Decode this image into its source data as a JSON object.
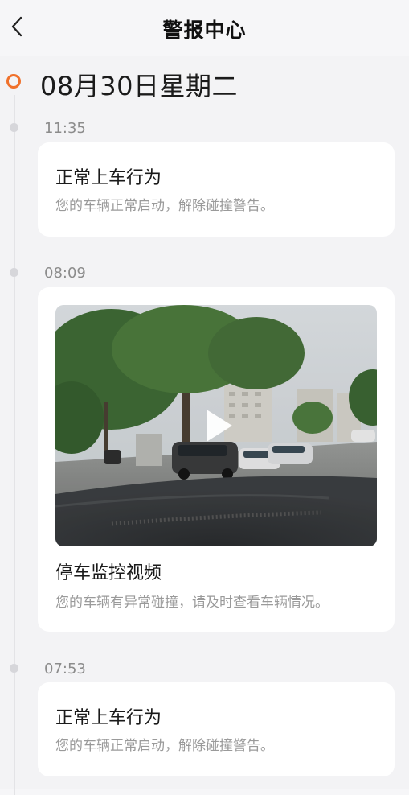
{
  "header": {
    "title": "警报中心",
    "back_icon": "chevron-left-icon"
  },
  "timeline": {
    "date": "08月30日星期二",
    "accent_color": "#f0712b",
    "events": [
      {
        "time": "11:35",
        "type": "text",
        "title": "正常上车行为",
        "description": "您的车辆正常启动，解除碰撞警告。"
      },
      {
        "time": "08:09",
        "type": "video",
        "title": "停车监控视频",
        "description": "您的车辆有异常碰撞，请及时查看车辆情况。",
        "play_icon": "play-icon"
      },
      {
        "time": "07:53",
        "type": "text",
        "title": "正常上车行为",
        "description": "您的车辆正常启动，解除碰撞警告。"
      }
    ]
  }
}
